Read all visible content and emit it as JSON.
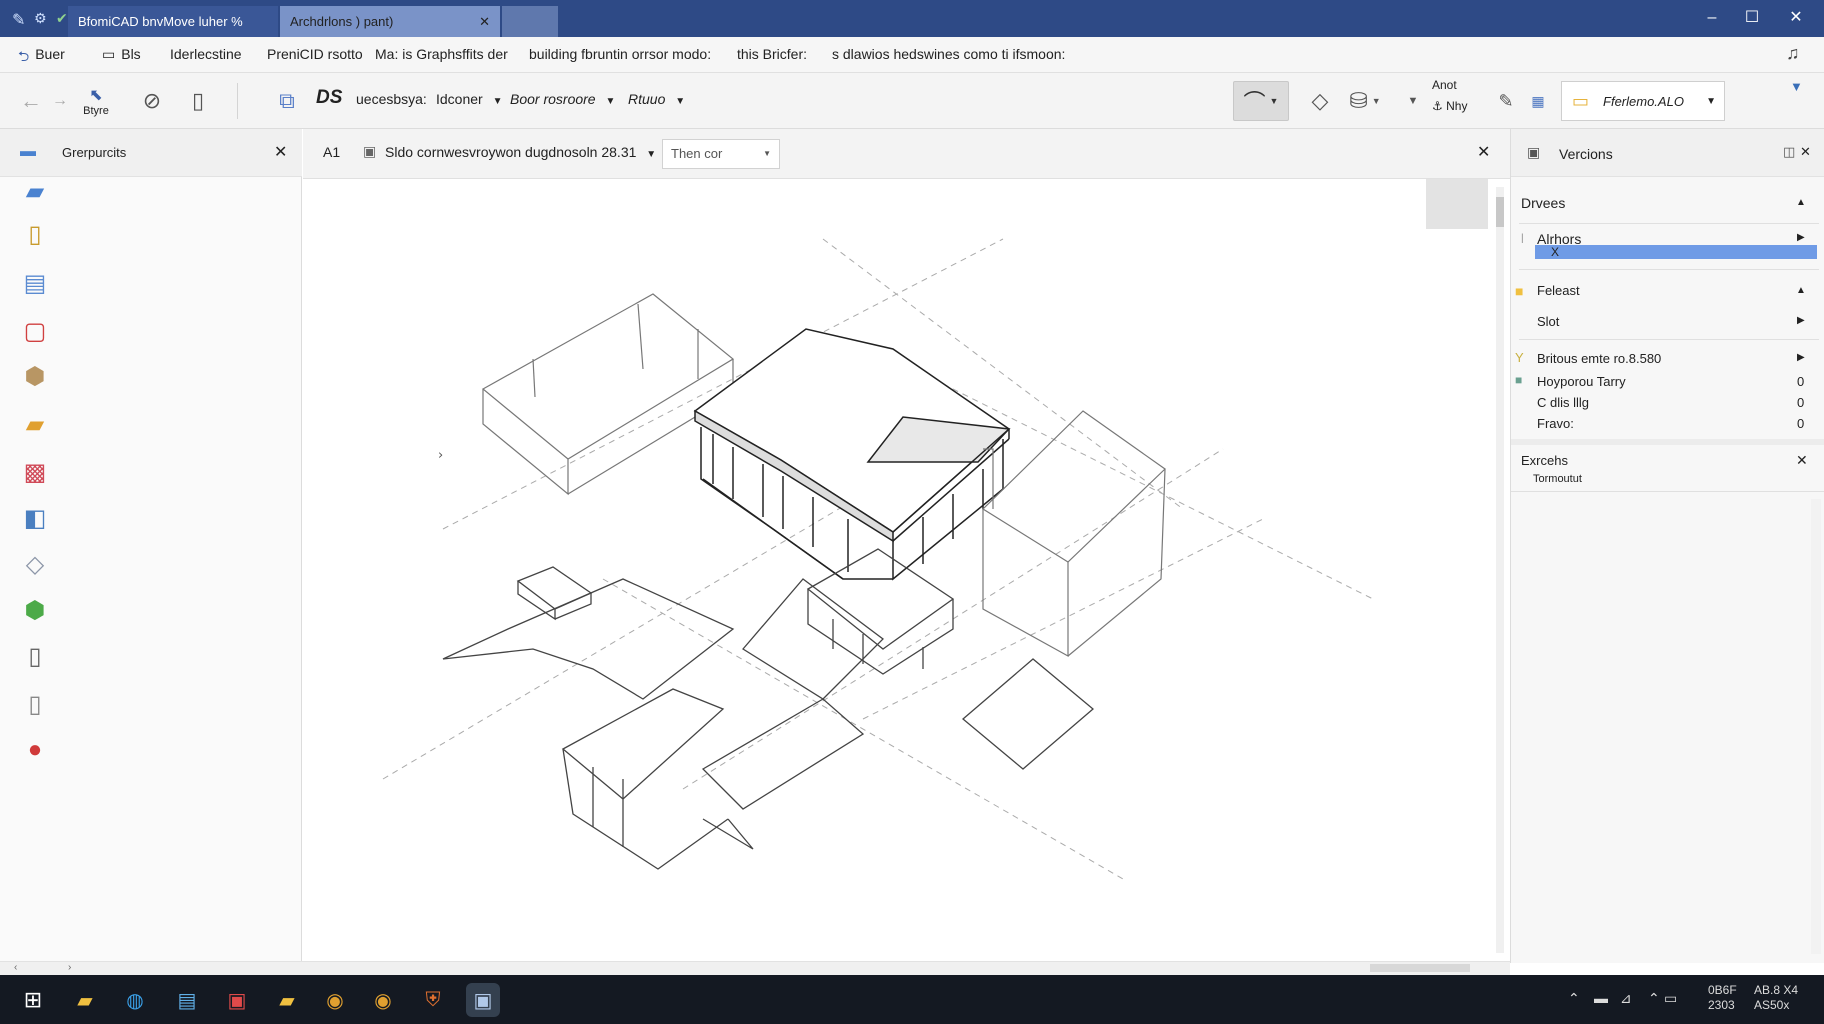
{
  "window": {
    "tabs": [
      {
        "label": "BfomiCAD bnvMove luher %"
      },
      {
        "label": "Archdrlons )  pant)"
      }
    ]
  },
  "menu": {
    "back_label": "Buer",
    "items": [
      "Bls",
      "Iderlecstine",
      "PreniCID rsotto",
      "Ma: is Graphsffits der",
      "building fbruntin orrsor modo:",
      "this Bricfer:",
      "s dlawios hedswines como ti ifsmoon:"
    ]
  },
  "toolbar": {
    "select_label": "Btyre",
    "ds_label": "DS",
    "dropdowns": [
      "uecesbsya:",
      "Idconer",
      "Boor rosroore",
      "Rtuuo"
    ],
    "anot_top": "Anot",
    "anot_bottom": "Nhy",
    "profile_label": "Fferlemo.ALO"
  },
  "left_panel": {
    "title": "Grerpurcits"
  },
  "document": {
    "a_label": "A1",
    "file_label": "Sldo cornwesvroywon dugdnosoln 28.31",
    "view_dropdown": "Then cor"
  },
  "right_panel": {
    "title": "Vercions",
    "sections": {
      "devices_label": "Drvees",
      "authors_label": "Alrhors",
      "selected_item": "X",
      "release_label": "Feleast",
      "slot_label": "Slot",
      "rows": [
        {
          "label": "Britous emte ro.8.580",
          "value": ""
        },
        {
          "label": "Hoyporou Tarry",
          "value": "0"
        },
        {
          "label": "C dlis lllg",
          "value": "0"
        },
        {
          "label": "Fravo:",
          "value": "0"
        }
      ],
      "extents_label": "Exrcehs",
      "extents_sub": "Tormoutut"
    }
  },
  "taskbar": {
    "tray_time": "0B6F\n2303",
    "tray_date": "AB.8 X4\nAS50x"
  },
  "colors": {
    "titlebar": "#2e4a86",
    "accent_selection": "#6f9be6",
    "taskbar": "#141922"
  }
}
